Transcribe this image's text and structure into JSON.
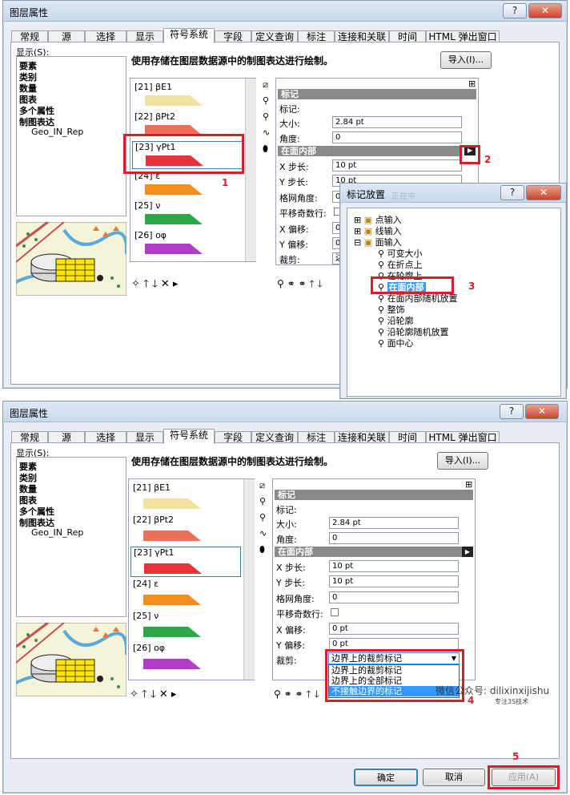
{
  "top_dialog": {
    "title": "图层属性",
    "tabs": [
      "常规",
      "源",
      "选择",
      "显示",
      "符号系统",
      "字段",
      "定义查询",
      "标注",
      "连接和关联",
      "时间",
      "HTML 弹出窗口"
    ],
    "show_label": "显示(S):",
    "show_items": [
      "要素",
      "类别",
      "数量",
      "图表",
      "多个属性",
      "制图表达",
      "Geo_IN_Rep"
    ],
    "description": "使用存储在图层数据源中的制图表达进行绘制。",
    "import_button": "导入(I)...",
    "symbols": [
      {
        "label": "[21] βE1",
        "color": "#f2e2a0"
      },
      {
        "label": "[22] βPt2",
        "color": "#ef6e5a"
      },
      {
        "label": "[23] γPt1",
        "color": "#e8323c"
      },
      {
        "label": "[24] ε",
        "color": "#f58c1e"
      },
      {
        "label": "[25] ν",
        "color": "#2aa84a"
      },
      {
        "label": "[26] οφ",
        "color": "#b03cc8"
      }
    ],
    "props": {
      "marker_header": "标记",
      "marker_label": "标记:",
      "size_label": "大小:",
      "size_value": "2.84 pt",
      "angle_label": "角度:",
      "angle_value": "0",
      "inside_header": "在面内部",
      "xstep_label": "X 步长:",
      "xstep_value": "10 pt",
      "ystep_label": "Y 步长:",
      "ystep_value": "10 pt",
      "grid_label": "格网角度:",
      "grid_value": "0",
      "shift_label": "平移奇数行:",
      "xoff_label": "X 偏移:",
      "xoff_value": "0 p",
      "yoff_label": "Y 偏移:",
      "yoff_value": "0 p",
      "clip_label": "裁剪:",
      "clip_value": "边"
    },
    "callouts": [
      "1",
      "2",
      "3"
    ]
  },
  "popup": {
    "title": "标记放置",
    "title_blur": "正在中",
    "nodes": [
      "点输入",
      "线输入",
      "面输入",
      "可变大小",
      "在折点上",
      "在轮廓上",
      "在面内部",
      "在面内部随机放置",
      "整饰",
      "沿轮廓",
      "沿轮廓随机放置",
      "面中心"
    ]
  },
  "bottom_dialog": {
    "title": "图层属性",
    "props": {
      "clip_value": "边界上的裁剪标记",
      "clip_options": [
        "边界上的裁剪标记",
        "边界上的全部标记",
        "不接触边界的标记"
      ],
      "xoff_value": "0 pt",
      "yoff_value": "0 pt"
    },
    "ok": "确定",
    "cancel": "取消",
    "apply": "应用(A)",
    "callouts": [
      "4",
      "5"
    ]
  },
  "watermark": {
    "line1": "微信公众号: dilixinxijishu",
    "line2": "专注3S技术"
  }
}
